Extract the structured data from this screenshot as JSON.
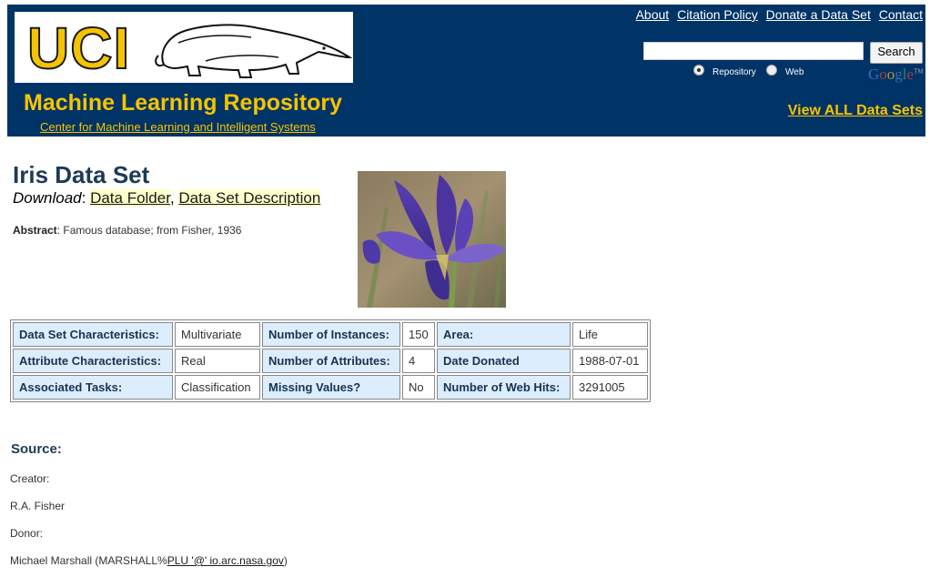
{
  "header": {
    "logo_text": "UCI",
    "title": "Machine Learning Repository",
    "subtitle": "Center for Machine Learning and Intelligent Systems",
    "nav_links": [
      "About",
      "Citation Policy",
      "Donate a Data Set",
      "Contact"
    ],
    "search": {
      "value": "",
      "button_label": "Search"
    },
    "radio_options": [
      {
        "label": "Repository",
        "selected": true
      },
      {
        "label": "Web",
        "selected": false
      }
    ],
    "google_label": "Google",
    "google_tm": "TM",
    "view_all": "View ALL Data Sets"
  },
  "dataset": {
    "title": "Iris Data Set",
    "download_label": "Download",
    "download_links": [
      "Data Folder",
      "Data Set Description"
    ],
    "abstract_label": "Abstract",
    "abstract_text": "Famous database; from Fisher, 1936"
  },
  "characteristics": [
    [
      {
        "key": "Data Set Characteristics:",
        "value": "Multivariate"
      },
      {
        "key": "Number of Instances:",
        "value": "150"
      },
      {
        "key": "Area:",
        "value": "Life"
      }
    ],
    [
      {
        "key": "Attribute Characteristics:",
        "value": "Real"
      },
      {
        "key": "Number of Attributes:",
        "value": "4"
      },
      {
        "key": "Date Donated",
        "value": "1988-07-01"
      }
    ],
    [
      {
        "key": "Associated Tasks:",
        "value": "Classification"
      },
      {
        "key": "Missing Values?",
        "value": "No"
      },
      {
        "key": "Number of Web Hits:",
        "value": "3291005"
      }
    ]
  ],
  "source": {
    "heading": "Source:",
    "creator_label": "Creator:",
    "creator": "R.A. Fisher",
    "donor_label": "Donor:",
    "donor_prefix": "Michael Marshall (MARSHALL%",
    "donor_email_link": "PLU '@' io.arc.nasa.gov",
    "donor_suffix": ")"
  },
  "colors": {
    "header_bg": "#003366",
    "accent_yellow": "#f5c400",
    "table_key_bg": "#dcedfd",
    "link_highlight": "#ffffcc"
  }
}
